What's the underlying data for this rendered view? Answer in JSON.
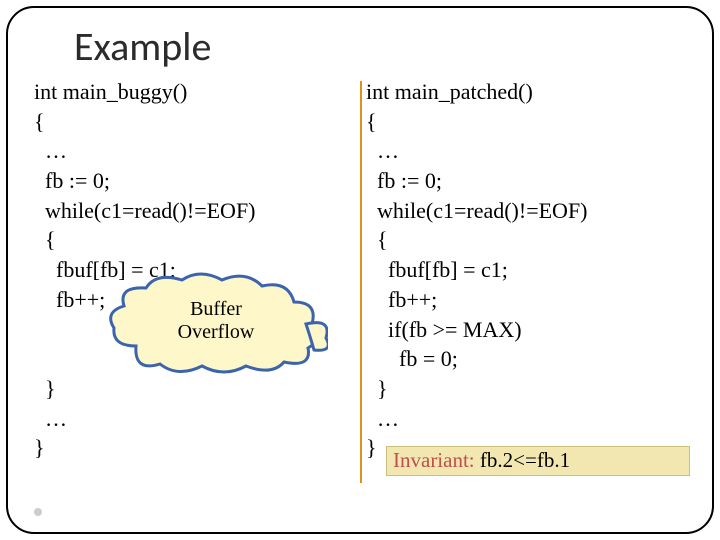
{
  "title": "Example",
  "code_left": "int main_buggy()\n{\n  …\n  fb := 0;\n  while(c1=read()!=EOF)\n  {\n    fbuf[fb] = c1;\n    fb++;\n\n\n  }\n  …\n}",
  "code_right": "int main_patched()\n{\n  …\n  fb := 0;\n  while(c1=read()!=EOF)\n  {\n    fbuf[fb] = c1;\n    fb++;\n    if(fb >= MAX)\n      fb = 0;\n  }\n  …\n}",
  "callout": {
    "line1": "Buffer",
    "line2": "Overflow"
  },
  "invariant": {
    "label": "Invariant:",
    "expr": " fb.2<=fb.1"
  },
  "colors": {
    "cloud_stroke": "#3b64ad",
    "cloud_fill": "#fdf7c9",
    "divider": "#e28f1e",
    "invariant_label": "#c0504d"
  }
}
